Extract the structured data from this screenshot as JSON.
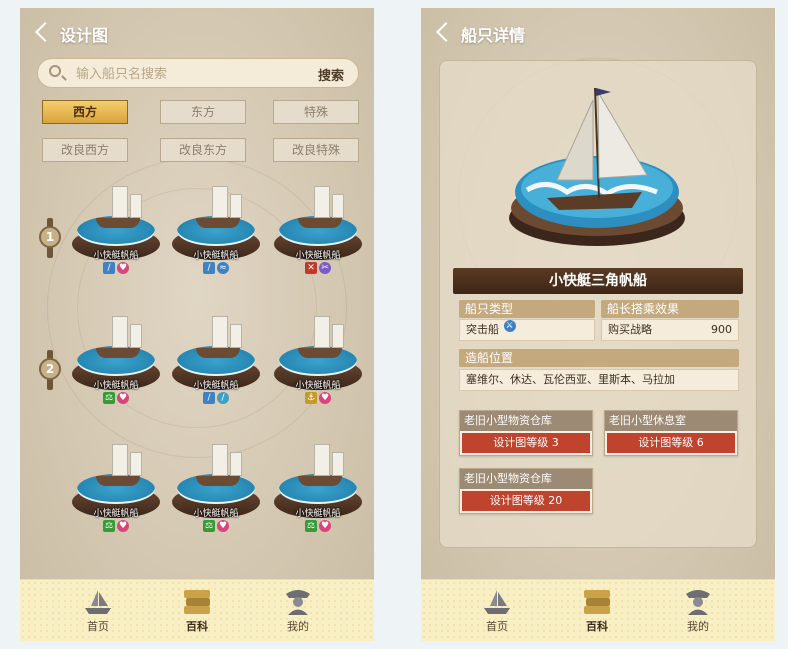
{
  "design_screen": {
    "title": "设计图",
    "search": {
      "placeholder": "输入船只名搜索",
      "button_label": "搜索"
    },
    "filters_row1": [
      "西方",
      "东方",
      "特殊"
    ],
    "filters_row2": [
      "改良西方",
      "改良东方",
      "改良特殊"
    ],
    "active_filter": "西方",
    "tiers": [
      "1",
      "2"
    ],
    "ships": [
      {
        "name": "小快艇帆船",
        "tags": [
          "sword-icon",
          "heart-icon"
        ]
      },
      {
        "name": "小快艇帆船",
        "tags": [
          "sword-icon",
          "wave-icon"
        ]
      },
      {
        "name": "小快艇帆船",
        "tags": [
          "cross-icon",
          "scissors-icon"
        ]
      },
      {
        "name": "小快艇帆船",
        "tags": [
          "scale-icon",
          "heart-icon"
        ]
      },
      {
        "name": "小快艇帆船",
        "tags": [
          "sword-icon",
          "wrench-icon"
        ]
      },
      {
        "name": "小快艇帆船",
        "tags": [
          "anchor-icon",
          "heart-icon"
        ]
      },
      {
        "name": "小快艇帆船",
        "tags": [
          "scale-icon",
          "heart-icon"
        ]
      },
      {
        "name": "小快艇帆船",
        "tags": [
          "scale-icon",
          "heart-icon"
        ]
      },
      {
        "name": "小快艇帆船",
        "tags": [
          "scale-icon",
          "heart-icon"
        ]
      }
    ]
  },
  "detail_screen": {
    "title": "船只详情",
    "ship_name": "小快艇三角帆船",
    "ship_type_label": "船只类型",
    "ship_type_value": "突击船",
    "captain_effect_label": "船长搭乘效果",
    "captain_effect_name": "购买战略",
    "captain_effect_value": "900",
    "build_location_label": "造船位置",
    "build_location_value": "塞维尔、休达、瓦伦西亚、里斯本、马拉加",
    "rooms": [
      {
        "name": "老旧小型物资仓库",
        "level": "设计图等级 3"
      },
      {
        "name": "老旧小型休息室",
        "level": "设计图等级 6"
      },
      {
        "name": "老旧小型物资仓库",
        "level": "设计图等级 20"
      }
    ]
  },
  "nav": {
    "home": "首页",
    "wiki": "百科",
    "mine": "我的",
    "active": "百科"
  },
  "colors": {
    "accent_gold": "#e0b04a",
    "plaque_brown": "#4a2f1d",
    "red_button": "#c0432d",
    "nav_bg": "#f9efc4"
  }
}
